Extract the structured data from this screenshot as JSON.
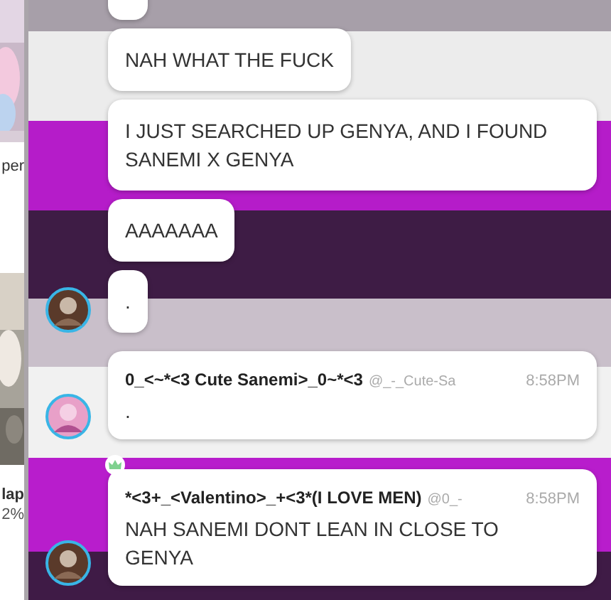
{
  "sidebar": {
    "cards": [
      {
        "kind": "picture",
        "label": "per"
      },
      {
        "kind": "picture",
        "label": "lap",
        "sub": "2%"
      }
    ]
  },
  "messages": [
    {
      "kind": "stub",
      "avatar": false
    },
    {
      "kind": "plain",
      "text": "NAH WHAT THE FUCK",
      "avatar": false
    },
    {
      "kind": "plain",
      "text": "I JUST SEARCHED UP GENYA, AND I FOUND SANEMI X GENYA",
      "avatar": false
    },
    {
      "kind": "plain",
      "text": "AAAAAAA",
      "avatar": false
    },
    {
      "kind": "plain",
      "text": ".",
      "avatar": true
    },
    {
      "kind": "named",
      "author": "0_<~*<3 Cute Sanemi>_0~*<3",
      "handle": "@_-_Cute-Sa",
      "time": "8:58PM",
      "text": ".",
      "avatar": true,
      "crown": false
    },
    {
      "kind": "named",
      "author": "*<3+_<Valentino>_+<3*(I LOVE MEN)",
      "handle": "@0_-",
      "time": "8:58PM",
      "text": "NAH SANEMI DONT LEAN IN CLOSE TO GENYA",
      "avatar": true,
      "crown": true
    }
  ]
}
